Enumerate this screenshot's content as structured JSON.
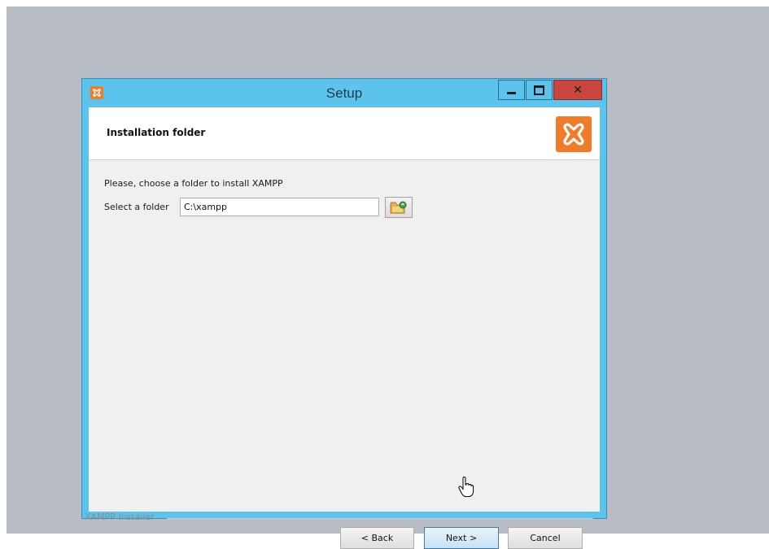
{
  "window": {
    "title": "Setup"
  },
  "header": {
    "title": "Installation folder"
  },
  "content": {
    "instruction": "Please, choose a folder to install XAMPP",
    "folder_label": "Select a folder",
    "folder_value": "C:\\xampp"
  },
  "footer": {
    "branding": "XAMPP Installer",
    "back_label": "< Back",
    "next_label": "Next >",
    "cancel_label": "Cancel"
  },
  "colors": {
    "titlebar": "#5cc4ec",
    "close_button": "#c9453e",
    "xampp_orange": "#f07c2a"
  },
  "icons": {
    "app": "xampp-logo-icon",
    "logo": "xampp-logo-icon",
    "browse": "folder-browse-icon",
    "cursor": "hand-pointer-icon"
  }
}
